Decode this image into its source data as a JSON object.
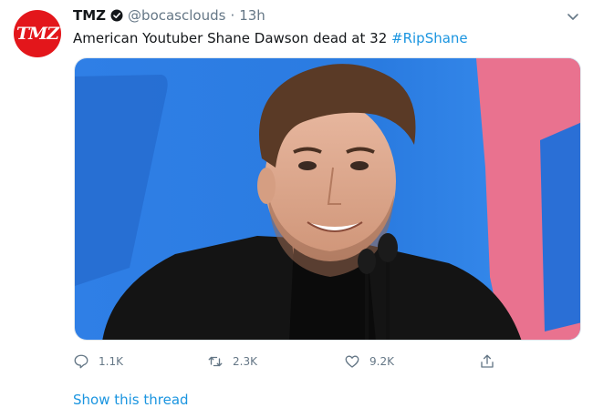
{
  "tweet": {
    "avatar_text": "TMZ",
    "display_name": "TMZ",
    "handle": "@bocasclouds",
    "separator": "·",
    "time": "13h",
    "text_main": "American Youtuber Shane Dawson dead at 32 ",
    "hashtag": "#RipShane",
    "media_icon": "photo-image",
    "actions": {
      "reply_count": "1.1K",
      "retweet_count": "2.3K",
      "like_count": "9.2K"
    },
    "show_thread": "Show this thread"
  },
  "colors": {
    "avatar_bg": "#e3161b",
    "link": "#1b95e0",
    "secondary_text": "#657786"
  }
}
